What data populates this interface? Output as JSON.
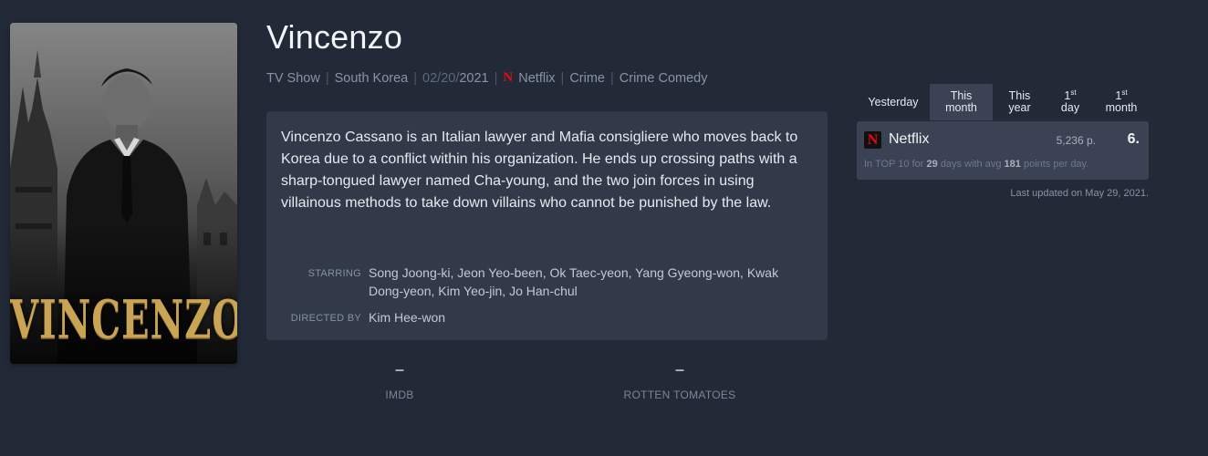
{
  "poster": {
    "title_text": "VINCENZO"
  },
  "title": "Vincenzo",
  "meta": {
    "type": "TV Show",
    "country": "South Korea",
    "date_prefix": "02/20/",
    "date_year": "2021",
    "service_icon": "N",
    "service": "Netflix",
    "genre_1": "Crime",
    "genre_2": "Crime Comedy"
  },
  "synopsis": "Vincenzo Cassano is an Italian lawyer and Mafia consigliere who moves back to Korea due to a conflict within his organization. He ends up crossing paths with a sharp-tongued lawyer named Cha-young, and the two join forces in using villainous methods to take down villains who cannot be punished by the law.",
  "credits": {
    "starring_label": "STARRING",
    "starring": "Song Joong-ki, Jeon Yeo-been, Ok Taec-yeon, Yang Gyeong-won, Kwak Dong-yeon, Kim Yeo-jin, Jo Han-chul",
    "directed_label": "DIRECTED BY",
    "directed": "Kim Hee-won"
  },
  "ratings": {
    "imdb_value": "–",
    "imdb_label": "IMDB",
    "rt_value": "–",
    "rt_label": "ROTTEN TOMATOES"
  },
  "tabs": {
    "yesterday": "Yesterday",
    "this_month_1": "This",
    "this_month_2": "month",
    "this_year_1": "This",
    "this_year_2": "year",
    "first_day_num": "1",
    "first_day_sup": "st",
    "first_day_word": "day",
    "first_month_num": "1",
    "first_month_sup": "st",
    "first_month_word": "month",
    "active": "this_month"
  },
  "ranking": {
    "service_icon": "N",
    "service": "Netflix",
    "points": "5,236 p.",
    "position": "6.",
    "detail_prefix": "In TOP 10 for",
    "days": "29",
    "detail_mid": "days with avg",
    "avg_points": "181",
    "detail_suffix": "points per day."
  },
  "updated": "Last updated on May 29, 2021.",
  "colors": {
    "background": "#222a38",
    "card": "#323a4a",
    "netflix_red": "#e50914",
    "poster_gold": "#c9a455"
  }
}
